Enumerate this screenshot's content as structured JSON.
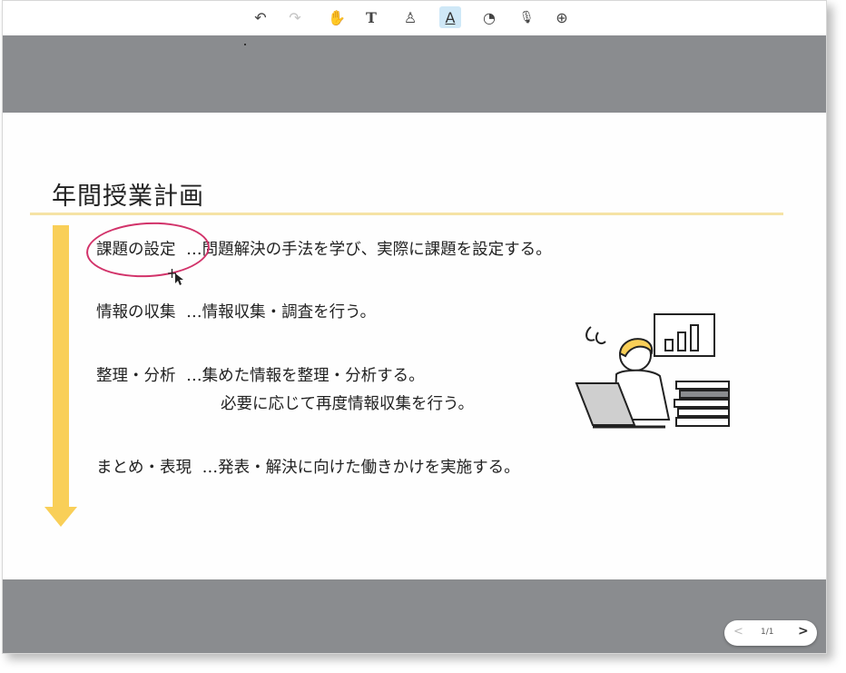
{
  "toolbar": {
    "tools": [
      {
        "icon": "undo-icon",
        "glyph": "↶"
      },
      {
        "icon": "redo-icon",
        "glyph": "↷"
      },
      {
        "icon": "hand-icon",
        "glyph": "✋"
      },
      {
        "icon": "text-icon",
        "glyph": "T"
      },
      {
        "icon": "stamp-icon",
        "glyph": "♙"
      },
      {
        "icon": "highlight-icon",
        "glyph": "A"
      },
      {
        "icon": "shape-icon",
        "glyph": "◔"
      },
      {
        "icon": "microphone-icon",
        "glyph": "🎙"
      },
      {
        "icon": "zoom-icon",
        "glyph": "⊕"
      }
    ]
  },
  "slide": {
    "title": "年間授業計画",
    "steps": [
      {
        "label": "課題の設定",
        "desc": "…問題解決の手法を学び、実際に課題を設定する。"
      },
      {
        "label": "情報の収集",
        "desc": "…情報収集・調査を行う。"
      },
      {
        "label": "整理・分析",
        "desc": "…集めた情報を整理・分析する。",
        "desc2": "必要に応じて再度情報収集を行う。"
      },
      {
        "label": "まとめ・表現",
        "desc": "…発表・解決に向けた働きかけを実施する。"
      }
    ]
  },
  "pager": {
    "page": "1/1"
  },
  "colors": {
    "accent_yellow": "#f9cf58",
    "annotation_pink": "#d2336a",
    "stage_gray": "#8a8c8f"
  }
}
